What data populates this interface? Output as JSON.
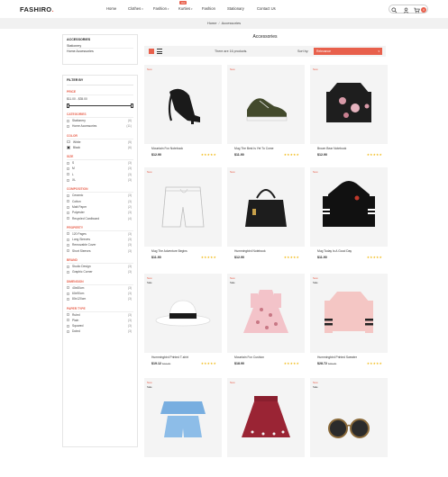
{
  "header": {
    "logo": "FASHIRO",
    "nav": [
      {
        "label": "Home",
        "caret": false
      },
      {
        "label": "Clothes",
        "caret": true
      },
      {
        "label": "Fashion",
        "caret": true
      },
      {
        "label": "Kurties",
        "caret": true
      },
      {
        "label": "Fashion",
        "caret": false
      },
      {
        "label": "Stationary",
        "caret": false
      },
      {
        "label": "Contact Us",
        "caret": false
      }
    ],
    "hot_badge": "Hot",
    "cart_count": "0"
  },
  "breadcrumb": {
    "home": "Home",
    "current": "Accessories"
  },
  "sidebar": {
    "categories": {
      "title": "ACCESSORIES",
      "items": [
        "Stationery",
        "Home Accessories"
      ]
    },
    "filter_title": "FILTER BY",
    "price": {
      "title": "PRICE",
      "range": "$11.00 - $35.00",
      "min_fraction": 0,
      "max_fraction": 1
    },
    "categories_filter": {
      "title": "CATEGORIES",
      "items": [
        {
          "label": "Stationery",
          "count": "(6)"
        },
        {
          "label": "Home Accessories",
          "count": "(11)"
        }
      ]
    },
    "color": {
      "title": "COLOR",
      "items": [
        {
          "label": "White",
          "count": "(5)",
          "color": "#ffffff"
        },
        {
          "label": "Black",
          "count": "(6)",
          "color": "#333333"
        }
      ]
    },
    "size": {
      "title": "SIZE",
      "items": [
        {
          "label": "S",
          "count": "(3)"
        },
        {
          "label": "M",
          "count": "(3)"
        },
        {
          "label": "L",
          "count": "(3)"
        },
        {
          "label": "XL",
          "count": "(3)"
        }
      ]
    },
    "composition": {
      "title": "COMPOSITION",
      "items": [
        {
          "label": "Ceramic",
          "count": "(3)"
        },
        {
          "label": "Cotton",
          "count": "(3)"
        },
        {
          "label": "Matt Paper",
          "count": "(2)"
        },
        {
          "label": "Polyester",
          "count": "(3)"
        },
        {
          "label": "Recycled Cardboard",
          "count": "(4)"
        }
      ]
    },
    "property": {
      "title": "PROPERTY",
      "items": [
        {
          "label": "120 Pages",
          "count": "(3)"
        },
        {
          "label": "Long Sleeves",
          "count": "(3)"
        },
        {
          "label": "Removable Cover",
          "count": "(3)"
        },
        {
          "label": "Short Sleeves",
          "count": "(3)"
        }
      ]
    },
    "brand": {
      "title": "BRAND",
      "items": [
        {
          "label": "Studio Design",
          "count": "(3)"
        },
        {
          "label": "Graphic Corner",
          "count": "(3)"
        }
      ]
    },
    "dimension": {
      "title": "DIMENSION",
      "items": [
        {
          "label": "40x60cm",
          "count": "(3)"
        },
        {
          "label": "60x90cm",
          "count": "(3)"
        },
        {
          "label": "80x120cm",
          "count": "(3)"
        }
      ]
    },
    "paper_type": {
      "title": "PAPER TYPE",
      "items": [
        {
          "label": "Ruled",
          "count": "(3)"
        },
        {
          "label": "Plain",
          "count": "(3)"
        },
        {
          "label": "Squared",
          "count": "(3)"
        },
        {
          "label": "Doted",
          "count": "(3)"
        }
      ]
    }
  },
  "main": {
    "title": "Accessories",
    "results": "There are 16 products.",
    "sort_label": "Sort by:",
    "sort_value": "Relevance"
  },
  "products": [
    {
      "name": "Mountain Fox Notebook",
      "price": "$12.90",
      "old_price": "",
      "new": true,
      "sale": false,
      "image": "sandal-icon"
    },
    {
      "name": "Mug The Best Is Yet To Come",
      "price": "$11.90",
      "old_price": "",
      "new": true,
      "sale": false,
      "image": "sneaker-icon"
    },
    {
      "name": "Brown Bear Notebook",
      "price": "$12.90",
      "old_price": "",
      "new": true,
      "sale": false,
      "image": "floral-jacket-icon"
    },
    {
      "name": "Mug The Adventure Begins",
      "price": "$11.90",
      "old_price": "",
      "new": true,
      "sale": false,
      "image": "shorts-icon"
    },
    {
      "name": "Hummingbird Notebook",
      "price": "$12.90",
      "old_price": "",
      "new": true,
      "sale": false,
      "image": "handbag-icon"
    },
    {
      "name": "Mug Today Is A Good Day",
      "price": "$11.90",
      "old_price": "",
      "new": true,
      "sale": false,
      "image": "hoodie-icon"
    },
    {
      "name": "Hummingbird Printed T-shirt",
      "price": "$19.12",
      "old_price": "$23.90",
      "new": true,
      "sale": true,
      "image": "hat-icon"
    },
    {
      "name": "Mountain Fox Cushion",
      "price": "$18.90",
      "old_price": "",
      "new": true,
      "sale": true,
      "image": "pink-dress-icon"
    },
    {
      "name": "Hummingbird Printed Sweater",
      "price": "$28.72",
      "old_price": "$35.90",
      "new": true,
      "sale": true,
      "image": "sweater-icon"
    },
    {
      "name": "",
      "price": "",
      "old_price": "",
      "new": true,
      "sale": true,
      "image": "blue-top-icon"
    },
    {
      "name": "",
      "price": "",
      "old_price": "",
      "new": true,
      "sale": false,
      "image": "skirt-icon"
    },
    {
      "name": "",
      "price": "",
      "old_price": "",
      "new": true,
      "sale": true,
      "image": "sunglasses-icon"
    }
  ],
  "labels": {
    "new": "New",
    "sale": "Sale",
    "rating": "★★★★★"
  }
}
